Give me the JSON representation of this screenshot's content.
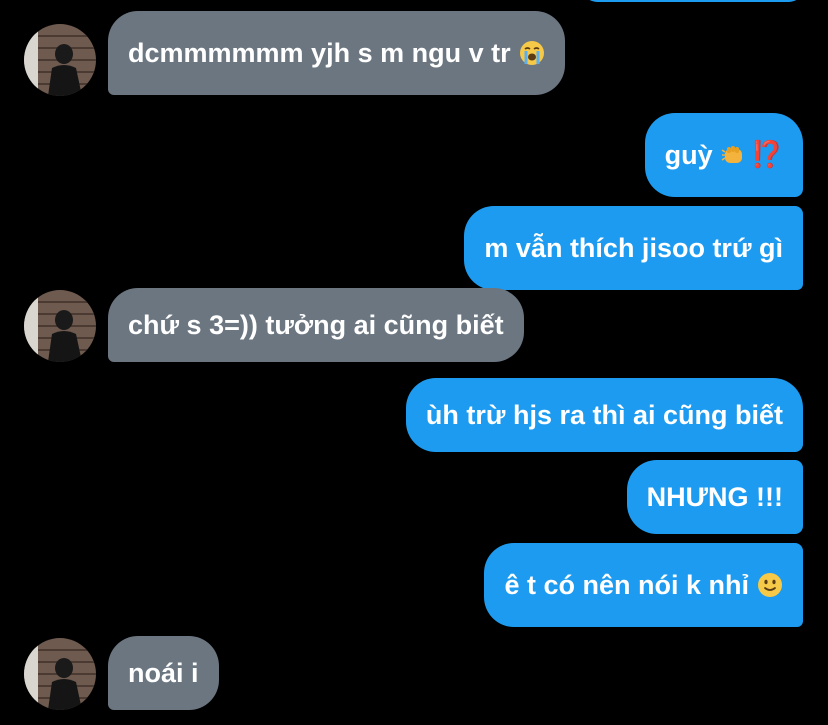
{
  "messages": [
    {
      "side": "in",
      "text": "dcmmmmmm yjh s m ngu v tr",
      "emoji": "loudly-crying-face-icon"
    },
    {
      "side": "out",
      "text": "guỳ",
      "emoji": "punch-fist-icon",
      "emoji2": "⁉️"
    },
    {
      "side": "out",
      "text": "m vẫn thích jisoo trứ gì"
    },
    {
      "side": "in",
      "text": "chứ s 3=)) tưởng ai cũng biết"
    },
    {
      "side": "out",
      "text": "ùh trừ hjs ra thì ai cũng biết"
    },
    {
      "side": "out",
      "text": "NHƯNG !!!"
    },
    {
      "side": "out",
      "text": "ê t có nên nói k nhỉ",
      "emoji": "slightly-smiling-face-icon"
    },
    {
      "side": "in",
      "text": "noái i"
    }
  ],
  "colors": {
    "background": "#000000",
    "incoming_bubble": "#6b7681",
    "outgoing_bubble": "#1d9bf0",
    "text": "#ffffff"
  }
}
